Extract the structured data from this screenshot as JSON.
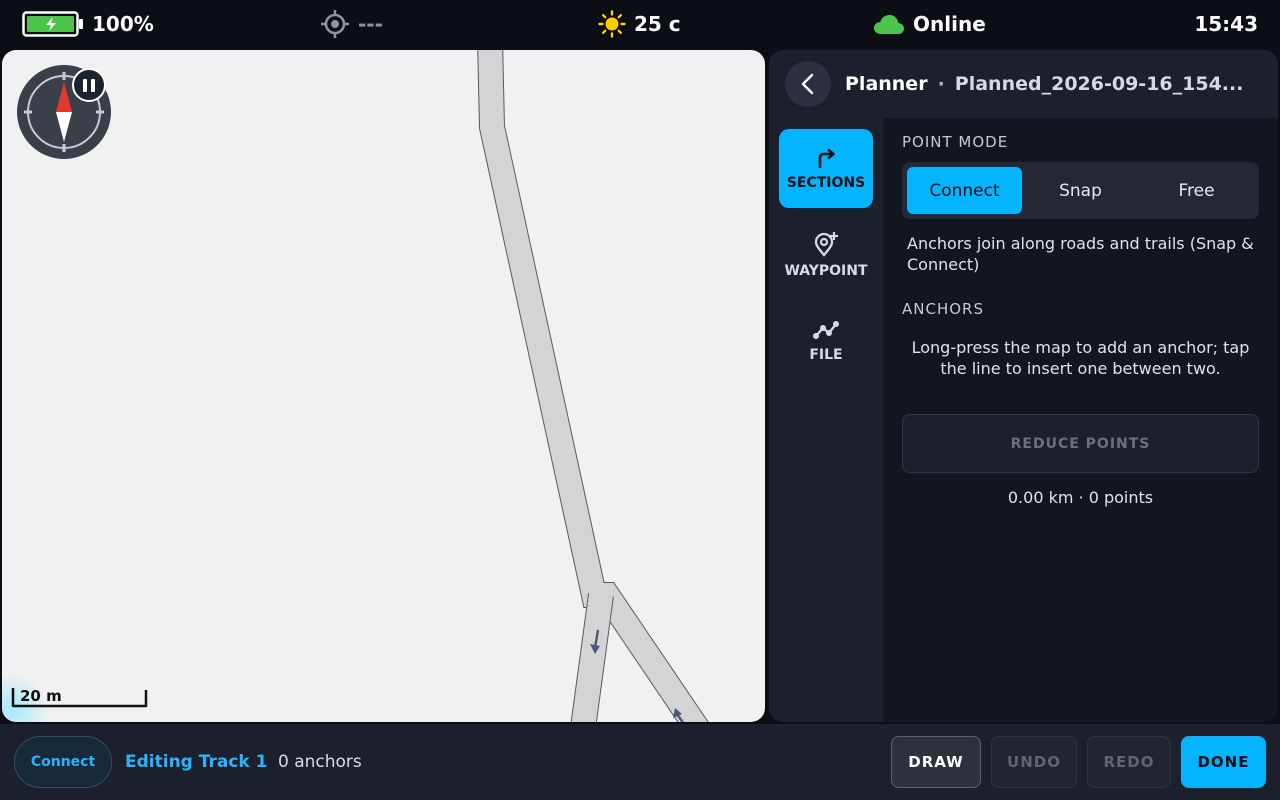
{
  "status_bar": {
    "battery": "100%",
    "gps": "---",
    "temperature": "25 c",
    "network": "Online",
    "time": "15:43",
    "icons": {
      "battery": "battery-charging-icon",
      "gps": "crosshair-icon",
      "weather": "sun-icon",
      "network": "cloud-icon"
    },
    "colors": {
      "battery": "#4cc44c",
      "sun": "#ffcc00",
      "cloud": "#4cc44c"
    }
  },
  "map": {
    "scale_label": "20 m",
    "icons": {
      "compass": "compass-icon",
      "pause": "pause-icon"
    }
  },
  "panel": {
    "title": "Planner",
    "separator": "·",
    "file_name": "Planned_2026-09-16_154...",
    "rail": [
      {
        "label": "SECTIONS",
        "icon": "turn-right-arrow-icon",
        "active": true
      },
      {
        "label": "WAYPOINT",
        "icon": "add-location-pin-icon",
        "active": false
      },
      {
        "label": "FILE",
        "icon": "route-line-icon",
        "active": false
      }
    ],
    "point_mode": {
      "label": "POINT MODE",
      "options": [
        "Connect",
        "Snap",
        "Free"
      ],
      "selected": "Connect",
      "description": "Anchors join along roads and trails (Snap & Connect)"
    },
    "anchors": {
      "label": "ANCHORS",
      "hint": "Long-press the map to add an anchor; tap the line to insert one between two."
    },
    "reduce_points": "REDUCE POINTS",
    "stats": "0.00 km · 0 points"
  },
  "bottom_bar": {
    "mode": "Connect",
    "editing": "Editing Track 1",
    "anchor_count": "0 anchors",
    "buttons": {
      "draw": "DRAW",
      "undo": "UNDO",
      "redo": "REDO",
      "done": "DONE"
    }
  },
  "colors": {
    "accent": "#04b4ff",
    "background": "#0b0e14",
    "panel": "#12161f"
  }
}
